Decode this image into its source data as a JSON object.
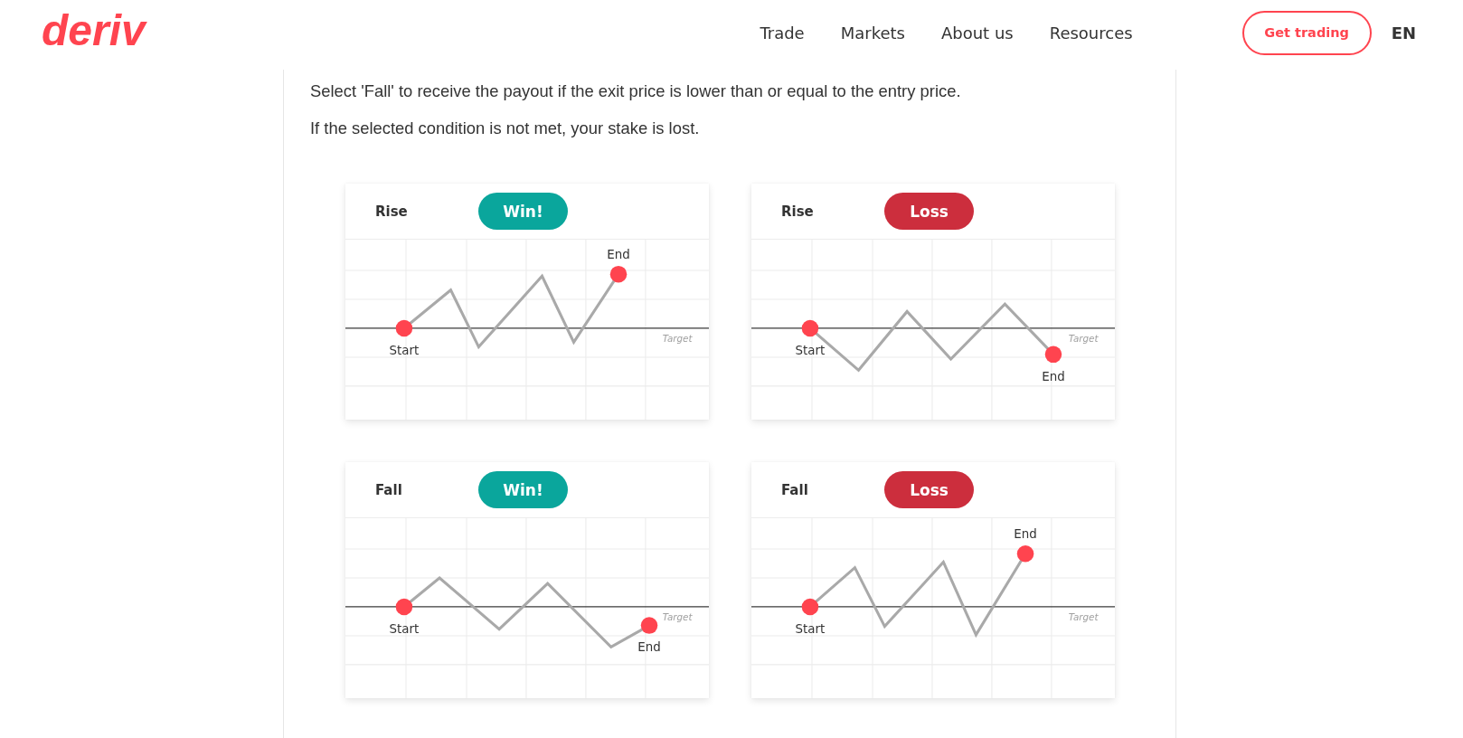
{
  "header": {
    "logo": "deriv",
    "nav": [
      "Trade",
      "Markets",
      "About us",
      "Resources"
    ],
    "cta": "Get trading",
    "language": "EN"
  },
  "content": {
    "paragraphs": [
      "Select 'Fall' to receive the payout if the exit price is lower than or equal to the entry price.",
      "If the selected condition is not met, your stake is lost."
    ],
    "cards": [
      {
        "label": "Rise",
        "result": {
          "kind": "win",
          "text": "Win!"
        },
        "chart": {
          "ends_above_target": true,
          "start_label": "Start",
          "end_label": "End",
          "target_label": "Target"
        }
      },
      {
        "label": "Rise",
        "result": {
          "kind": "loss",
          "text": "Loss"
        },
        "chart": {
          "ends_above_target": false,
          "start_label": "Start",
          "end_label": "End",
          "target_label": "Target"
        }
      },
      {
        "label": "Fall",
        "result": {
          "kind": "win",
          "text": "Win!"
        },
        "chart": {
          "ends_above_target": false,
          "start_label": "Start",
          "end_label": "End",
          "target_label": "Target"
        }
      },
      {
        "label": "Fall",
        "result": {
          "kind": "loss",
          "text": "Loss"
        },
        "chart": {
          "ends_above_target": true,
          "start_label": "Start",
          "end_label": "End",
          "target_label": "Target"
        }
      }
    ]
  }
}
